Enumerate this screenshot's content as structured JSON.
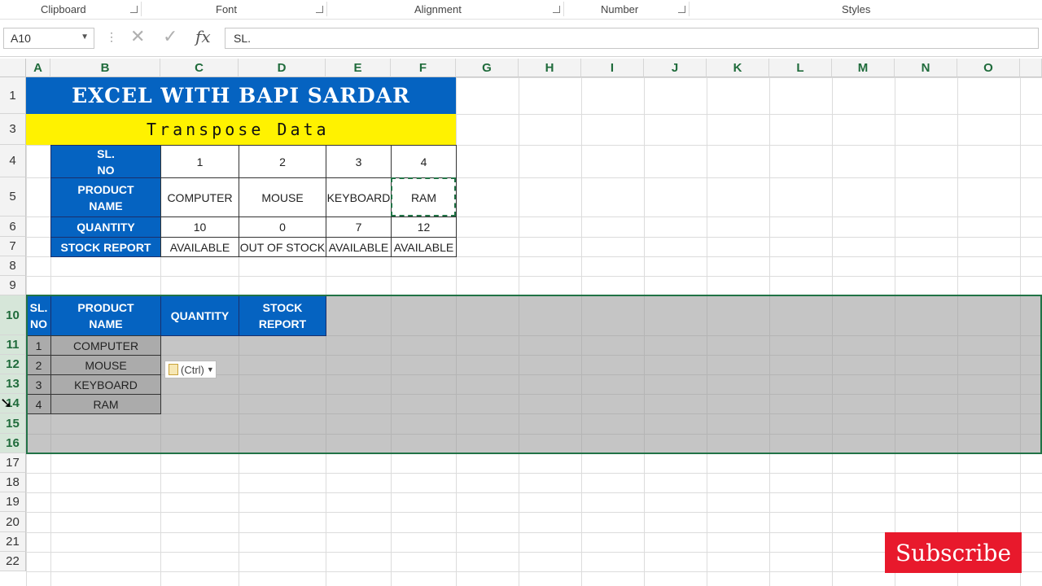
{
  "ribbon": {
    "groups": [
      "Clipboard",
      "Font",
      "Alignment",
      "Number",
      "Styles"
    ]
  },
  "formula_bar": {
    "name_box": "A10",
    "content": "SL.",
    "cancel_icon": "x-icon",
    "enter_icon": "check-icon",
    "fx_label": "fx"
  },
  "columns": [
    "A",
    "B",
    "C",
    "D",
    "E",
    "F",
    "G",
    "H",
    "I",
    "J",
    "K",
    "L",
    "M",
    "N",
    "O"
  ],
  "rows": [
    "1",
    "3",
    "4",
    "5",
    "6",
    "7",
    "8",
    "9",
    "10",
    "11",
    "12",
    "13",
    "14",
    "15",
    "16",
    "17",
    "18",
    "19",
    "20",
    "21",
    "22"
  ],
  "selected_rows": [
    "10",
    "11",
    "12",
    "13",
    "14",
    "15",
    "16"
  ],
  "sheet": {
    "title": "EXCEL WITH BAPI SARDAR",
    "subtitle": "Transpose Data",
    "source_table": {
      "row_headers": [
        "SL.\nNO",
        "PRODUCT\nNAME",
        "QUANTITY",
        "STOCK REPORT"
      ],
      "sl_no": [
        "1",
        "2",
        "3",
        "4"
      ],
      "product_name": [
        "COMPUTER",
        "MOUSE",
        "KEYBOARD",
        "RAM"
      ],
      "quantity": [
        "10",
        "0",
        "7",
        "12"
      ],
      "stock_report": [
        "AVAILABLE",
        "OUT OF STOCK",
        "AVAILABLE",
        "AVAILABLE"
      ]
    },
    "transposed_table": {
      "headers": [
        "SL.\nNO",
        "PRODUCT\nNAME",
        "QUANTITY",
        "STOCK\nREPORT"
      ],
      "rows": [
        {
          "sl": "1",
          "name": "COMPUTER"
        },
        {
          "sl": "2",
          "name": "MOUSE"
        },
        {
          "sl": "3",
          "name": "KEYBOARD"
        },
        {
          "sl": "4",
          "name": "RAM"
        }
      ]
    },
    "paste_options": "(Ctrl)"
  },
  "overlay": {
    "subscribe": "Subscribe"
  },
  "colors": {
    "header_blue": "#0563c1",
    "subtitle_yellow": "#fff200",
    "excel_green": "#217346",
    "subscribe_red": "#e8192c"
  }
}
